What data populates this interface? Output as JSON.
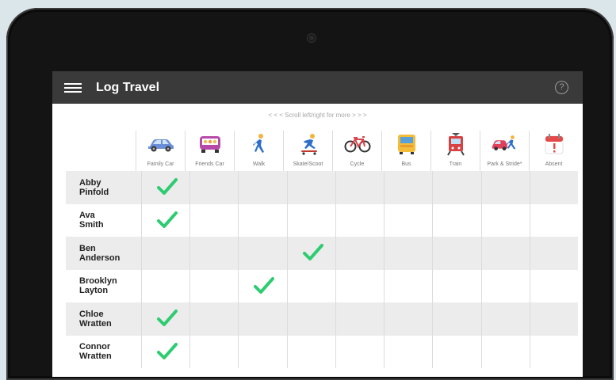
{
  "app": {
    "title": "Log Travel",
    "help_icon": "help-circle-icon",
    "menu_icon": "hamburger-menu-icon"
  },
  "scroll_hint": "< < < Scroll left/right for more > > >",
  "colors": {
    "appbar": "#3a3a3a",
    "tick": "#2ecc71",
    "row_shade": "#ececec"
  },
  "columns": [
    {
      "label": "Family Car",
      "icon": "family-car-icon"
    },
    {
      "label": "Friends Car",
      "icon": "friends-car-icon"
    },
    {
      "label": "Walk",
      "icon": "walk-icon"
    },
    {
      "label": "Skate/Scoot",
      "icon": "skate-scoot-icon"
    },
    {
      "label": "Cycle",
      "icon": "bicycle-icon"
    },
    {
      "label": "Bus",
      "icon": "bus-icon"
    },
    {
      "label": "Train",
      "icon": "train-icon"
    },
    {
      "label": "Park & Stride*",
      "icon": "park-and-stride-icon"
    },
    {
      "label": "Absent",
      "icon": "absent-calendar-icon"
    }
  ],
  "rows": [
    {
      "name": "Abby\nPinfold",
      "selected": 0
    },
    {
      "name": "Ava\nSmith",
      "selected": 0
    },
    {
      "name": "Ben\nAnderson",
      "selected": 3
    },
    {
      "name": "Brooklyn\nLayton",
      "selected": 2
    },
    {
      "name": "Chloe\nWratten",
      "selected": 0
    },
    {
      "name": "Connor\nWratten",
      "selected": 0
    }
  ]
}
